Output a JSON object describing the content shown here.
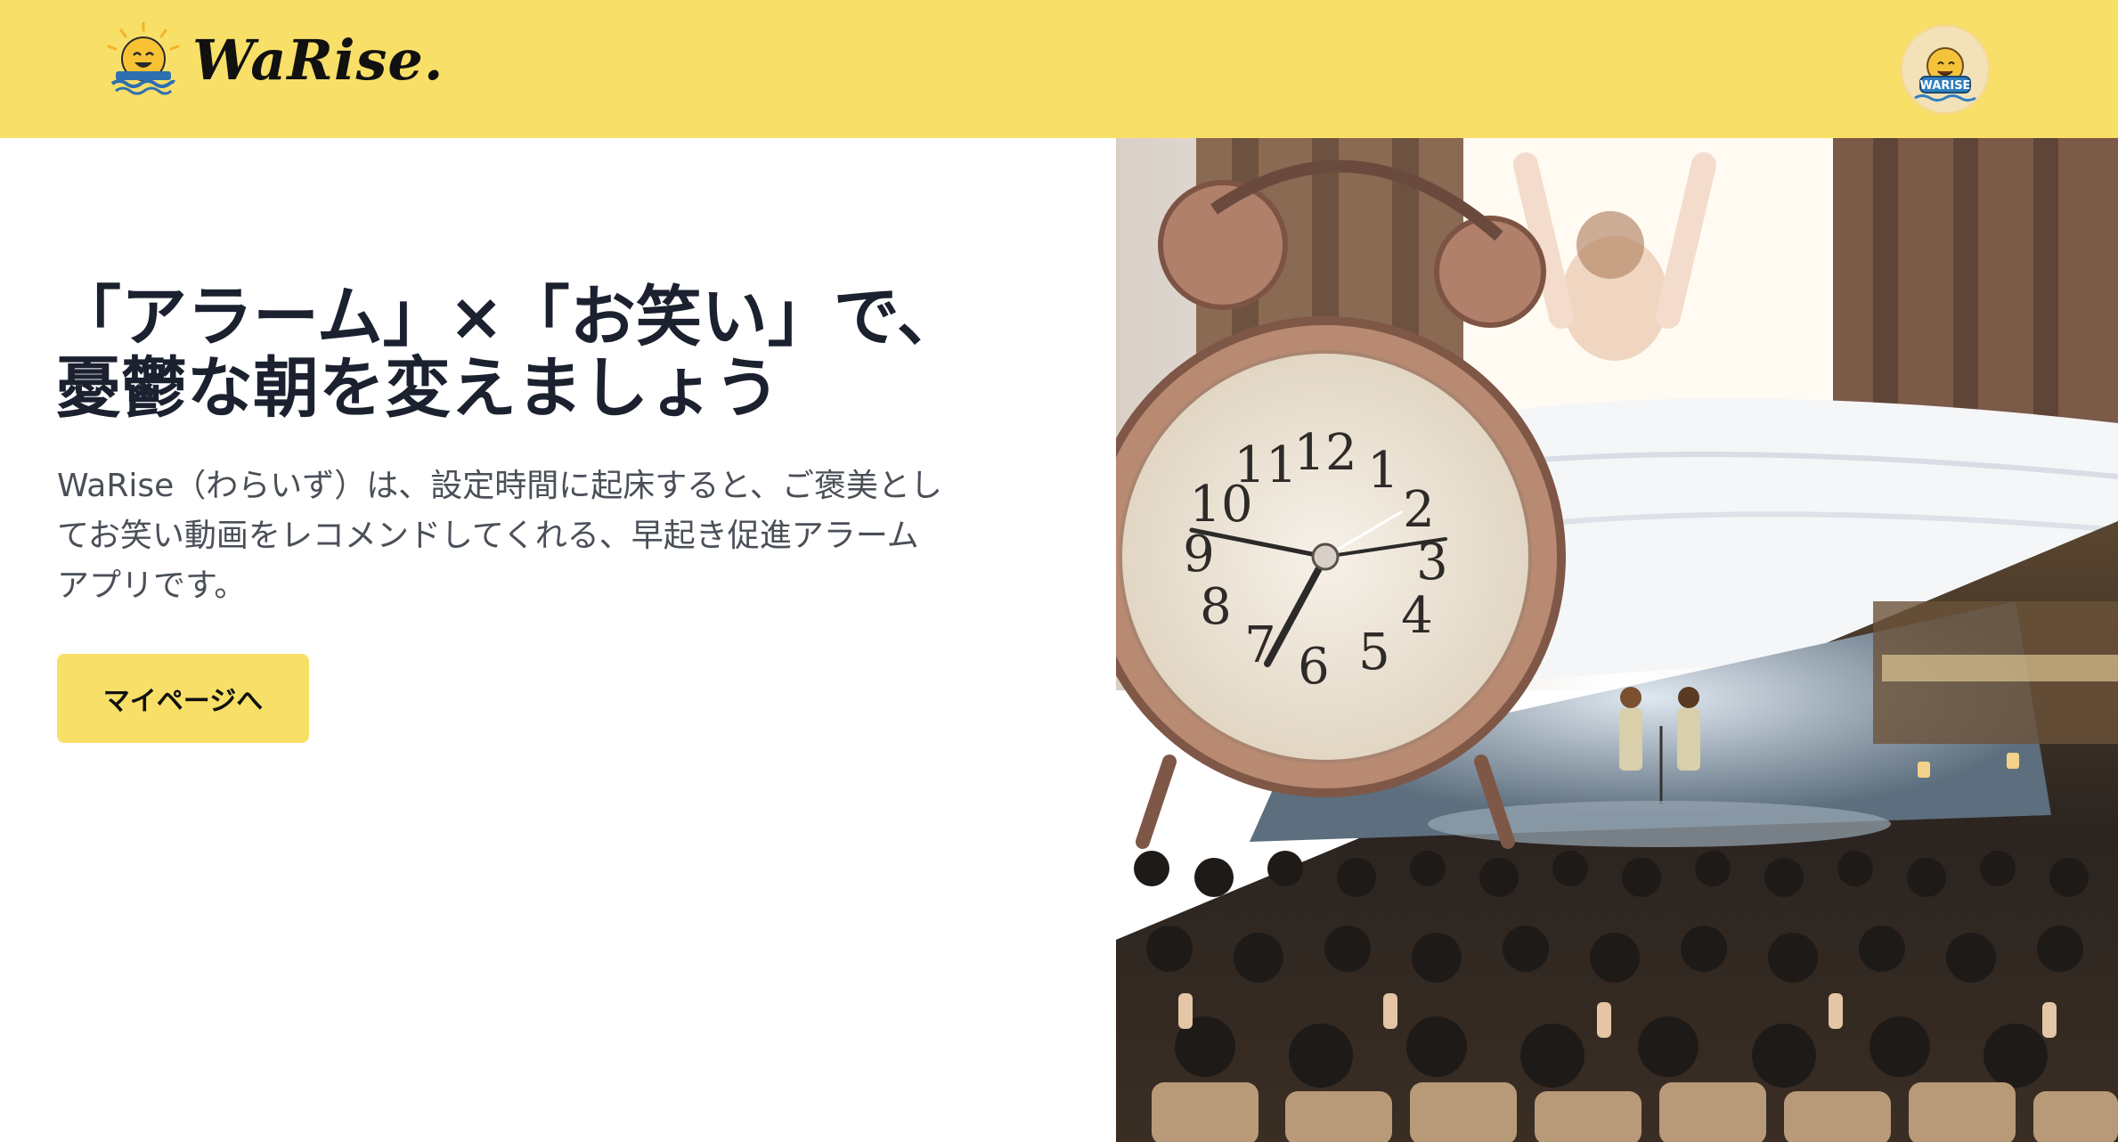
{
  "header": {
    "logo_text": "WaRise.",
    "logo_icon": "sun-smile-boat-icon",
    "avatar_label": "WARISE",
    "brand_color": "#f8df68"
  },
  "hero": {
    "headline_line1": "「アラーム」×「お笑い」で、",
    "headline_line2": "憂鬱な朝を変えましょう",
    "description": "WaRise（わらいず）は、設定時間に起床すると、ご褒美としてお笑い動画をレコメンドしてくれる、早起き促進アラームアプリです。",
    "cta_label": "マイページへ"
  },
  "hero_image": {
    "depicts": [
      "alarm-clock",
      "waking-person",
      "comedy-stage-audience"
    ],
    "clock_numbers": [
      "12",
      "1",
      "2",
      "3",
      "4",
      "5",
      "6",
      "7",
      "8",
      "9",
      "10",
      "11"
    ]
  }
}
